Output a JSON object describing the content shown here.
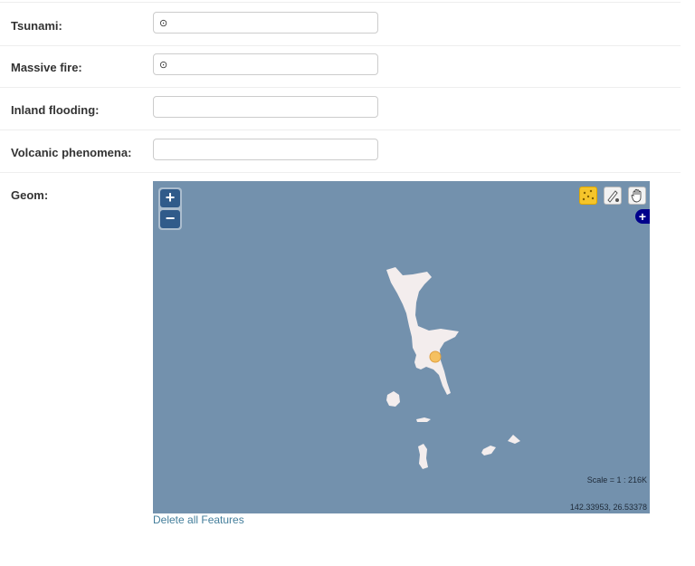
{
  "fields": [
    {
      "label": "Tsunami:",
      "value": "⊙",
      "placeholder": ""
    },
    {
      "label": "Massive fire:",
      "value": "⊙",
      "placeholder": ""
    },
    {
      "label": "Inland flooding:",
      "value": "",
      "placeholder": ""
    },
    {
      "label": "Volcanic phenomena:",
      "value": "",
      "placeholder": ""
    }
  ],
  "geom": {
    "label": "Geom:",
    "zoom_in": "+",
    "zoom_out": "−",
    "layer_switcher": "+",
    "scale_text": "Scale = 1 : 216K",
    "coords_text": "142.33953, 26.53378",
    "delete_link": "Delete all Features",
    "tools": [
      "point-tool-icon",
      "draw-tool-icon",
      "pan-hand-icon"
    ],
    "colors": {
      "sea": "#7391ad",
      "land": "#f3eded",
      "marker": "#f5c060",
      "active_tool": "#f5c52b"
    }
  }
}
